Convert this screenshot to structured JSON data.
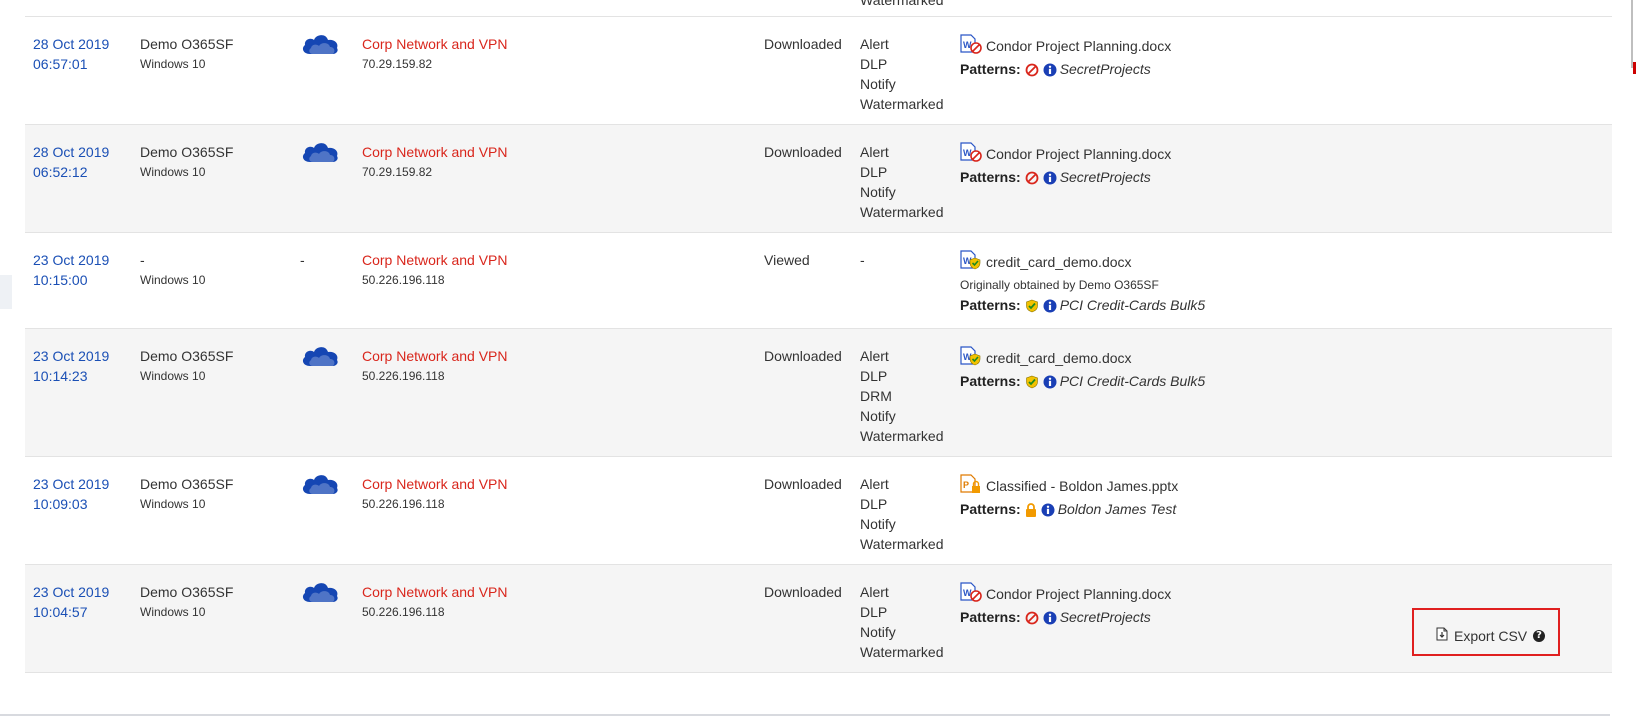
{
  "top_row": {
    "policy": "Watermarked"
  },
  "rows": [
    {
      "date": "28 Oct 2019",
      "time": "06:57:01",
      "user": "Demo O365SF",
      "device": "Windows 10",
      "app_icon": "onedrive-cloud-icon",
      "location": "Corp Network and VPN",
      "ip": "70.29.159.82",
      "activity": "Downloaded",
      "policies": [
        "Alert",
        "DLP",
        "Notify",
        "Watermarked"
      ],
      "file": {
        "icon": "word-doc-blocked-icon",
        "name": "Condor Project Planning.docx"
      },
      "origin": "",
      "patterns_label": "Patterns:",
      "pattern_icon": "block-icon",
      "pattern": "SecretProjects"
    },
    {
      "date": "28 Oct 2019",
      "time": "06:52:12",
      "user": "Demo O365SF",
      "device": "Windows 10",
      "app_icon": "onedrive-cloud-icon",
      "location": "Corp Network and VPN",
      "ip": "70.29.159.82",
      "activity": "Downloaded",
      "policies": [
        "Alert",
        "DLP",
        "Notify",
        "Watermarked"
      ],
      "file": {
        "icon": "word-doc-blocked-icon",
        "name": "Condor Project Planning.docx"
      },
      "origin": "",
      "patterns_label": "Patterns:",
      "pattern_icon": "block-icon",
      "pattern": "SecretProjects"
    },
    {
      "date": "23 Oct 2019",
      "time": "10:15:00",
      "user": "-",
      "device": "Windows 10",
      "app_icon": "",
      "app_text": "-",
      "location": "Corp Network and VPN",
      "ip": "50.226.196.118",
      "activity": "Viewed",
      "policies": [
        "-"
      ],
      "file": {
        "icon": "word-doc-protected-icon",
        "name": "credit_card_demo.docx"
      },
      "origin": "Originally obtained by Demo O365SF",
      "patterns_label": "Patterns:",
      "pattern_icon": "shield-check-icon",
      "pattern": "PCI Credit-Cards Bulk5"
    },
    {
      "date": "23 Oct 2019",
      "time": "10:14:23",
      "user": "Demo O365SF",
      "device": "Windows 10",
      "app_icon": "onedrive-cloud-icon",
      "location": "Corp Network and VPN",
      "ip": "50.226.196.118",
      "activity": "Downloaded",
      "policies": [
        "Alert",
        "DLP",
        "DRM",
        "Notify",
        "Watermarked"
      ],
      "file": {
        "icon": "word-doc-protected-icon",
        "name": "credit_card_demo.docx"
      },
      "origin": "",
      "patterns_label": "Patterns:",
      "pattern_icon": "shield-check-icon",
      "pattern": "PCI Credit-Cards Bulk5"
    },
    {
      "date": "23 Oct 2019",
      "time": "10:09:03",
      "user": "Demo O365SF",
      "device": "Windows 10",
      "app_icon": "onedrive-cloud-icon",
      "location": "Corp Network and VPN",
      "ip": "50.226.196.118",
      "activity": "Downloaded",
      "policies": [
        "Alert",
        "DLP",
        "Notify",
        "Watermarked"
      ],
      "file": {
        "icon": "powerpoint-locked-icon",
        "name": "Classified - Boldon James.pptx"
      },
      "origin": "",
      "patterns_label": "Patterns:",
      "pattern_icon": "lock-icon",
      "pattern": "Boldon James Test"
    },
    {
      "date": "23 Oct 2019",
      "time": "10:04:57",
      "user": "Demo O365SF",
      "device": "Windows 10",
      "app_icon": "onedrive-cloud-icon",
      "location": "Corp Network and VPN",
      "ip": "50.226.196.118",
      "activity": "Downloaded",
      "policies": [
        "Alert",
        "DLP",
        "Notify",
        "Watermarked"
      ],
      "file": {
        "icon": "word-doc-blocked-icon",
        "name": "Condor Project Planning.docx"
      },
      "origin": "",
      "patterns_label": "Patterns:",
      "pattern_icon": "block-icon",
      "pattern": "SecretProjects"
    }
  ],
  "footer": {
    "export_label": "Export CSV",
    "export_icon": "csv-file-icon",
    "help_icon": "question-circle-icon",
    "help_glyph": "?"
  },
  "colors": {
    "link": "#1a4fb5",
    "location": "#d9261c",
    "highlight": "#e02020",
    "cloud": "#1546b3"
  }
}
